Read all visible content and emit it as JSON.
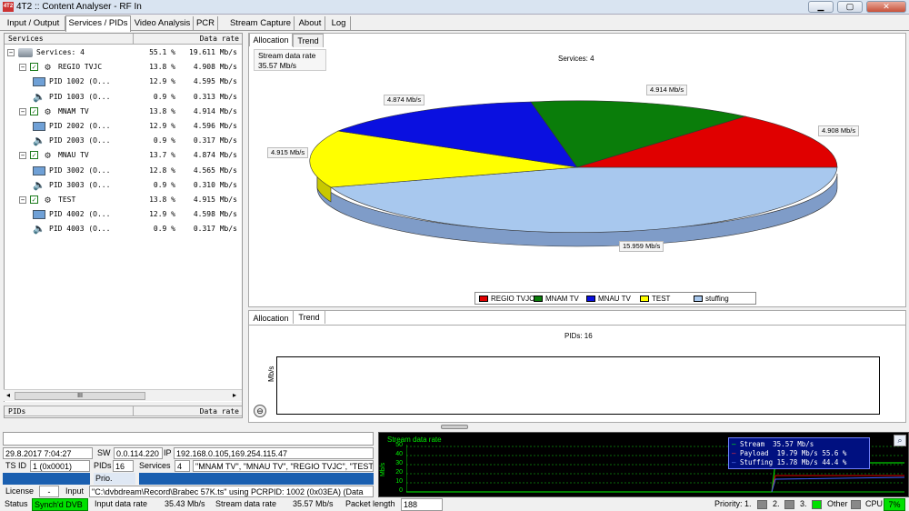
{
  "window": {
    "title": "4T2 :: Content Analyser - RF In",
    "icon": "app-icon",
    "controls": [
      "minimize",
      "maximize",
      "close"
    ]
  },
  "tabs": [
    "Input / Output",
    "Services / PIDs",
    "Video Analysis",
    "PCR",
    "Stream Capture",
    "About",
    "Log"
  ],
  "active_tab": "Services / PIDs",
  "tree": {
    "headers": {
      "name": "Services",
      "rate": "Data rate"
    },
    "rows": [
      {
        "name": "Services: 4",
        "pct": "55.1 %",
        "rate": "19.611 Mb/s",
        "icon": "disk-icon"
      },
      {
        "name": "REGIO TVJC",
        "pct": "13.8 %",
        "rate": "4.908 Mb/s",
        "icon": "gear-icon"
      },
      {
        "name": "PID 1002 (O...",
        "pct": "12.9 %",
        "rate": "4.595 Mb/s",
        "icon": "monitor-icon"
      },
      {
        "name": "PID 1003 (O...",
        "pct": "0.9 %",
        "rate": "0.313 Mb/s",
        "icon": "speaker-icon"
      },
      {
        "name": "MNAM TV",
        "pct": "13.8 %",
        "rate": "4.914 Mb/s",
        "icon": "gear-icon"
      },
      {
        "name": "PID 2002 (O...",
        "pct": "12.9 %",
        "rate": "4.596 Mb/s",
        "icon": "monitor-icon"
      },
      {
        "name": "PID 2003 (O...",
        "pct": "0.9 %",
        "rate": "0.317 Mb/s",
        "icon": "speaker-icon"
      },
      {
        "name": "MNAU TV",
        "pct": "13.7 %",
        "rate": "4.874 Mb/s",
        "icon": "gear-icon"
      },
      {
        "name": "PID 3002 (O...",
        "pct": "12.8 %",
        "rate": "4.565 Mb/s",
        "icon": "monitor-icon"
      },
      {
        "name": "PID 3003 (O...",
        "pct": "0.9 %",
        "rate": "0.310 Mb/s",
        "icon": "speaker-icon"
      },
      {
        "name": "TEST",
        "pct": "13.8 %",
        "rate": "4.915 Mb/s",
        "icon": "gear-icon"
      },
      {
        "name": "PID 4002 (O...",
        "pct": "12.9 %",
        "rate": "4.598 Mb/s",
        "icon": "monitor-icon"
      },
      {
        "name": "PID 4003 (O...",
        "pct": "0.9 %",
        "rate": "0.317 Mb/s",
        "icon": "speaker-icon"
      }
    ],
    "footer": {
      "name": "PIDs",
      "rate": "Data rate"
    },
    "scroll_grip": "III"
  },
  "allocation": {
    "tabs": [
      "Allocation",
      "Trend"
    ],
    "stream_label": "Stream data rate",
    "stream_value": "35.57 Mb/s",
    "title": "Services: 4",
    "labels": {
      "regio": "4.908 Mb/s",
      "mnam": "4.914 Mb/s",
      "mnau": "4.874 Mb/s",
      "test": "4.915 Mb/s",
      "stuffing": "15.959 Mb/s"
    },
    "legend": [
      "REGIO TVJC",
      "MNAM TV",
      "MNAU TV",
      "TEST",
      "stuffing"
    ],
    "colors": {
      "regio": "#e00000",
      "mnam": "#0a7d0a",
      "mnau": "#0a10e0",
      "test": "#ffff00",
      "stuffing": "#a8c8ee"
    }
  },
  "trend": {
    "tabs": [
      "Allocation",
      "Trend"
    ],
    "title": "PIDs: 16",
    "ylabel": "Mb/s",
    "zoom_icon": "zoom-icon"
  },
  "info": {
    "datetime": "29.8.2017 7:04:27",
    "sw_label": "SW",
    "sw": "0.0.114.220",
    "ip_label": "IP",
    "ip": "192.168.0.105,169.254.115.47",
    "tsid_label": "TS ID",
    "tsid": "1 (0x0001)",
    "pids_label": "PIDs",
    "pids": "16",
    "services_label": "Services",
    "services": "4",
    "services_list": "\"MNAM TV\", \"MNAU TV\", \"REGIO TVJC\", \"TEST\"",
    "prio": "Prio.",
    "license_label": "License",
    "license": "-",
    "input_label": "Input",
    "input": "\"C:\\dvbdream\\Record\\Brabec 57K.ts\" using PCRPID: 1002 (0x03EA) (Data"
  },
  "graph": {
    "title": "Stream data rate",
    "ylabel": "Mb/s",
    "yticks": [
      "50",
      "40",
      "30",
      "20",
      "10",
      "0"
    ],
    "legend": [
      {
        "name": "Stream",
        "value": "35.57 Mb/s",
        "pct": ""
      },
      {
        "name": "Payload",
        "value": "19.79 Mb/s",
        "pct": "55.6 %"
      },
      {
        "name": "Stuffing",
        "value": "15.78 Mb/s",
        "pct": "44.4 %"
      }
    ]
  },
  "status": {
    "status_label": "Status",
    "status": "Synch'd DVB",
    "input_rate_label": "Input data rate",
    "input_rate": "35.43  Mb/s",
    "stream_rate_label": "Stream data rate",
    "stream_rate": "35.57  Mb/s",
    "packet_label": "Packet length",
    "packet": "188",
    "priority_label": "Priority: 1.",
    "p2": "2.",
    "p3": "3.",
    "other": "Other",
    "cpu_label": "CPU",
    "cpu": "7%"
  }
}
